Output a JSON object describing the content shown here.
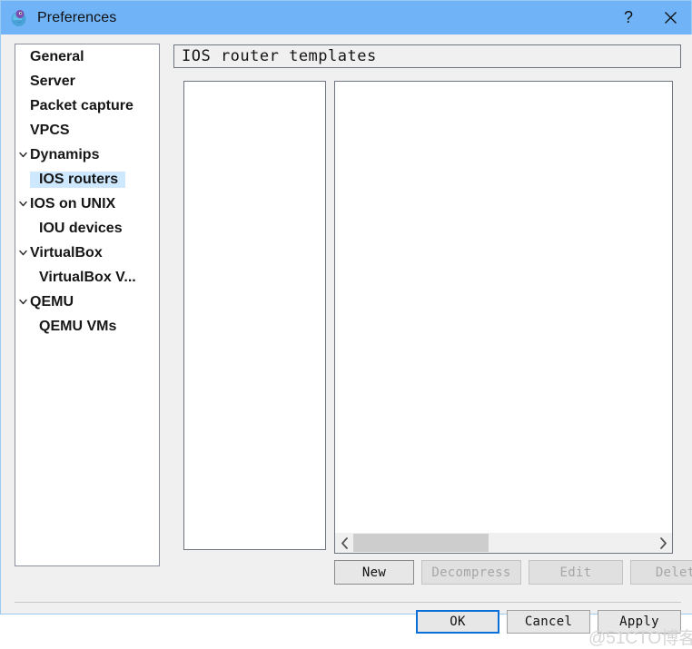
{
  "window": {
    "title": "Preferences",
    "logo_icon": "gns3-chameleon-logo-icon",
    "titlebar_color": "#71b3f7",
    "help_label": "?",
    "close_label": "✕"
  },
  "sidebar": {
    "items": [
      {
        "label": "General",
        "level": "root",
        "expandable": false,
        "selected": false
      },
      {
        "label": "Server",
        "level": "root",
        "expandable": false,
        "selected": false
      },
      {
        "label": "Packet capture",
        "level": "root",
        "expandable": false,
        "selected": false
      },
      {
        "label": "VPCS",
        "level": "root",
        "expandable": false,
        "selected": false
      },
      {
        "label": "Dynamips",
        "level": "root",
        "expandable": true,
        "selected": false
      },
      {
        "label": "IOS routers",
        "level": "child",
        "expandable": false,
        "selected": true
      },
      {
        "label": "IOS on UNIX",
        "level": "root",
        "expandable": true,
        "selected": false
      },
      {
        "label": "IOU devices",
        "level": "child",
        "expandable": false,
        "selected": false
      },
      {
        "label": "VirtualBox",
        "level": "root",
        "expandable": true,
        "selected": false
      },
      {
        "label": "VirtualBox V...",
        "level": "child",
        "expandable": false,
        "selected": false
      },
      {
        "label": "QEMU",
        "level": "root",
        "expandable": true,
        "selected": false
      },
      {
        "label": "QEMU VMs",
        "level": "child",
        "expandable": false,
        "selected": false
      }
    ],
    "selection_color": "#cde8ff"
  },
  "main": {
    "group_title": "IOS router templates",
    "left_list_items": [],
    "right_list_items": [],
    "scrollbar": {
      "left_arrow_icon": "chevron-left-icon",
      "right_arrow_icon": "chevron-right-icon",
      "thumb_percent": 45
    },
    "actions": [
      {
        "label": "New",
        "enabled": true
      },
      {
        "label": "Decompress",
        "enabled": false
      },
      {
        "label": "Edit",
        "enabled": false
      },
      {
        "label": "Delete",
        "enabled": false
      }
    ]
  },
  "footer": {
    "ok_label": "OK",
    "cancel_label": "Cancel",
    "apply_label": "Apply",
    "default_button": "OK",
    "focus_color": "#0a6fd6"
  },
  "watermark": {
    "text": "@51CTO博客"
  }
}
